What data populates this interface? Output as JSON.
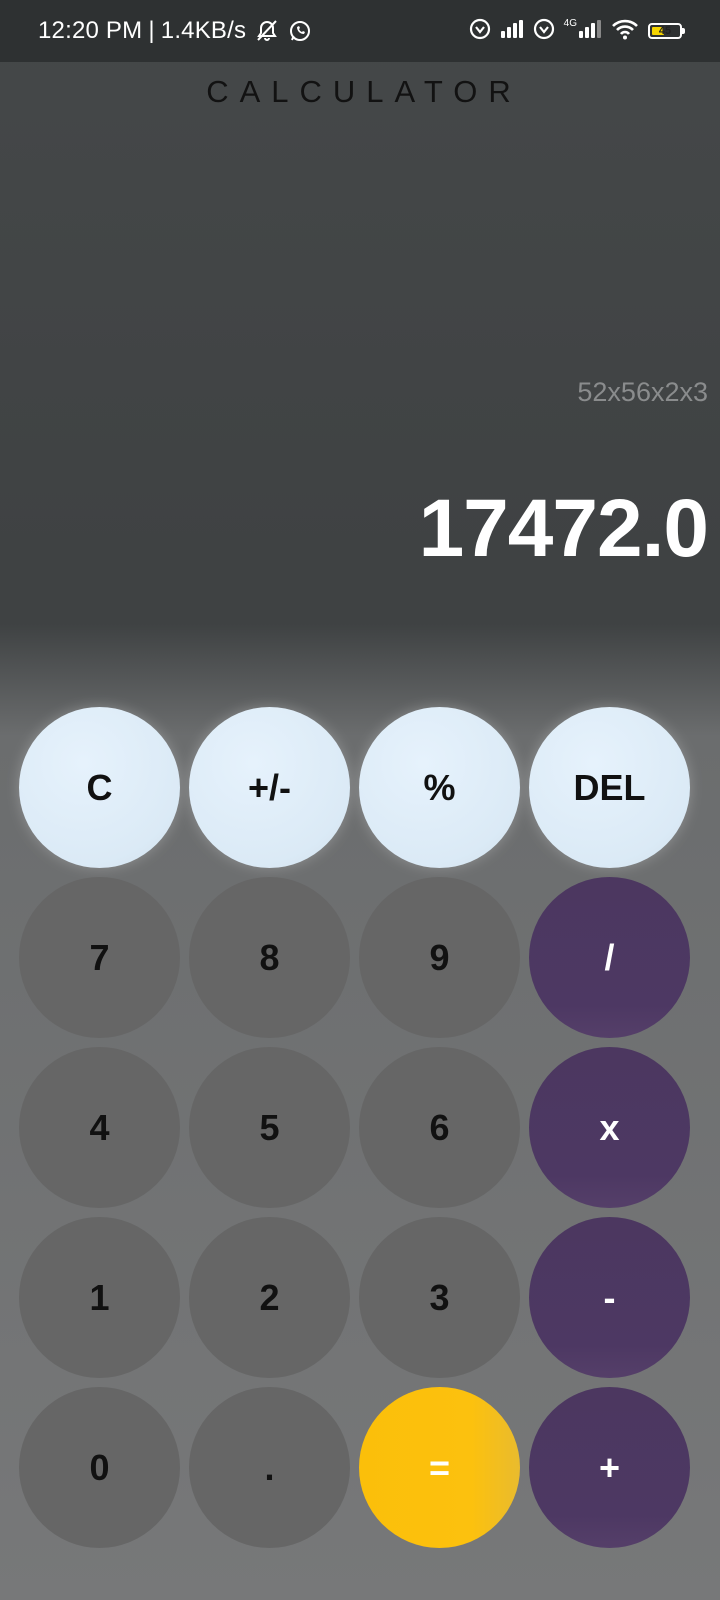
{
  "status_bar": {
    "time": "12:20 PM",
    "separator": "|",
    "net_speed": "1.4KB/s",
    "network_label": "4G",
    "battery_level": "45",
    "icons": [
      "vibrate-off-icon",
      "whatsapp-icon",
      "vpn-icon",
      "signal-icon",
      "vpn-icon",
      "signal-4g-icon",
      "wifi-icon",
      "battery-icon"
    ],
    "colors": {
      "background": "#2e3132",
      "battery_fill": "#f5d400"
    }
  },
  "app": {
    "title": "CALCULATOR"
  },
  "display": {
    "expression": "52x56x2x3",
    "result": "17472.0"
  },
  "keypad": {
    "rows": [
      [
        {
          "label": "C",
          "type": "light",
          "name": "clear-button"
        },
        {
          "label": "+/-",
          "type": "light",
          "name": "sign-toggle-button"
        },
        {
          "label": "%",
          "type": "light",
          "name": "percent-button"
        },
        {
          "label": "DEL",
          "type": "light",
          "name": "delete-button"
        }
      ],
      [
        {
          "label": "7",
          "type": "num",
          "name": "digit-7-button"
        },
        {
          "label": "8",
          "type": "num",
          "name": "digit-8-button"
        },
        {
          "label": "9",
          "type": "num",
          "name": "digit-9-button"
        },
        {
          "label": "/",
          "type": "op",
          "name": "divide-button"
        }
      ],
      [
        {
          "label": "4",
          "type": "num",
          "name": "digit-4-button"
        },
        {
          "label": "5",
          "type": "num",
          "name": "digit-5-button"
        },
        {
          "label": "6",
          "type": "num",
          "name": "digit-6-button"
        },
        {
          "label": "x",
          "type": "op",
          "name": "multiply-button"
        }
      ],
      [
        {
          "label": "1",
          "type": "num",
          "name": "digit-1-button"
        },
        {
          "label": "2",
          "type": "num",
          "name": "digit-2-button"
        },
        {
          "label": "3",
          "type": "num",
          "name": "digit-3-button"
        },
        {
          "label": "-",
          "type": "op",
          "name": "subtract-button"
        }
      ],
      [
        {
          "label": "0",
          "type": "num",
          "name": "digit-0-button"
        },
        {
          "label": ".",
          "type": "num",
          "name": "decimal-button"
        },
        {
          "label": "=",
          "type": "eq",
          "name": "equals-button"
        },
        {
          "label": "+",
          "type": "op",
          "name": "add-button"
        }
      ]
    ],
    "colors": {
      "light": "#dbeaf6",
      "number": "#666666",
      "operator": "#4d3863",
      "equals": "#fcc10e"
    }
  }
}
